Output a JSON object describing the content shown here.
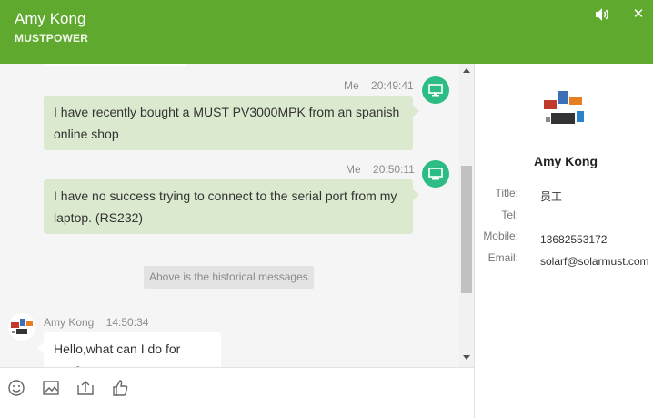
{
  "header": {
    "name": "Amy Kong",
    "company": "MUSTPOWER",
    "speaker_icon": "speaker-icon",
    "close_symbol": "✕"
  },
  "messages": [
    {
      "sender": "Me",
      "time": "20:49:41",
      "text": "I have recently bought a MUST PV3000MPK from an spanish online shop",
      "avatar_icon": "monitor-icon"
    },
    {
      "sender": "Me",
      "time": "20:50:11",
      "text": "I have no success trying to connect to the serial port from my laptop. (RS232)",
      "avatar_icon": "monitor-icon"
    },
    {
      "sender": "Amy Kong",
      "time": "14:50:34",
      "text": "Hello,what can I do for you?"
    }
  ],
  "history_note": "Above is the historical messages",
  "toolbar": {
    "items": [
      "emoji-icon",
      "image-icon",
      "upload-icon",
      "thumbs-up-icon"
    ]
  },
  "profile": {
    "name": "Amy Kong",
    "fields": [
      {
        "label": "Title:",
        "value": "员工"
      },
      {
        "label": "Tel:",
        "value": ""
      },
      {
        "label": "Mobile:",
        "value": "13682553172"
      },
      {
        "label": "Email:",
        "value": "solarf@solarmust.com"
      }
    ]
  },
  "colors": {
    "header": "#5ea92e",
    "my_bubble": "#dbe9cf",
    "my_avatar": "#2dbd84",
    "chat_bg": "#f5f5f5"
  }
}
